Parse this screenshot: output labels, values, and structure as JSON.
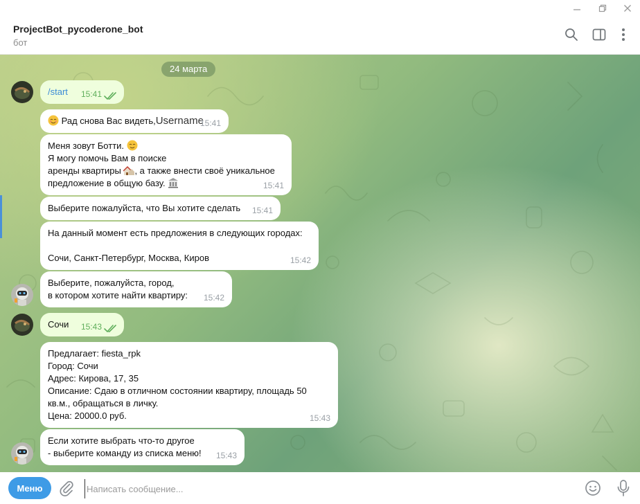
{
  "window": {
    "minimize_glyph": "—",
    "restore_glyph": "❐",
    "close_glyph": "✕"
  },
  "header": {
    "title": "ProjectBot_pycoderone_bot",
    "subtitle": "бот"
  },
  "chat": {
    "date": "24 марта",
    "messages": [
      {
        "id": "m1",
        "from": "user",
        "text": "/start",
        "time": "15:41",
        "read": true
      },
      {
        "id": "m2",
        "from": "bot",
        "emoji": "relieved-face",
        "text": "Рад снова Вас видеть,",
        "username": "Username",
        "time": "15:41"
      },
      {
        "id": "m3",
        "from": "bot",
        "line1": "Меня зовут Ботти. ",
        "line2": "Я могу помочь Вам в поиске",
        "line3a": "аренды квартиры ",
        "line3b": ", а также внести своё уникальное",
        "line4": "предложение в общую базу. ",
        "time": "15:41"
      },
      {
        "id": "m4",
        "from": "bot",
        "text": "Выберите пожалуйста, что Вы хотите сделать",
        "time": "15:41"
      },
      {
        "id": "m5",
        "from": "bot",
        "text": "На данный момент есть предложения в следующих городах:\n\nСочи, Санкт-Петербург, Москва, Киров",
        "time": "15:42"
      },
      {
        "id": "m6",
        "from": "bot",
        "text": "Выберите, пожалуйста, город,\nв котором хотите найти квартиру:",
        "time": "15:42"
      },
      {
        "id": "m7",
        "from": "user",
        "text": "Сочи",
        "time": "15:43",
        "read": true
      },
      {
        "id": "m8",
        "from": "bot",
        "text": "Предлагает: fiesta_rpk\nГород: Сочи\nАдрес: Кирова, 17, 35\nОписание: Сдаю в отличном состоянии квартиру, площадь 50\nкв.м., обращаться в личку.\nЦена: 20000.0 руб.",
        "time": "15:43"
      },
      {
        "id": "m9",
        "from": "bot",
        "text": "Если хотите выбрать что-то другое\n - выберите команду из списка меню!",
        "time": "15:43"
      }
    ]
  },
  "composer": {
    "menu_label": "Меню",
    "placeholder": "Написать сообщение..."
  },
  "colors": {
    "accent": "#3e9be6",
    "outgoing_bubble": "#effedd",
    "read_check": "#5fae5b",
    "incoming_bubble": "#ffffff"
  },
  "icons": [
    "minimize-icon",
    "restore-icon",
    "close-icon",
    "search-icon",
    "sidebar-toggle-icon",
    "more-vertical-icon",
    "attach-icon",
    "emoji-icon",
    "microphone-icon",
    "double-check-icon"
  ]
}
